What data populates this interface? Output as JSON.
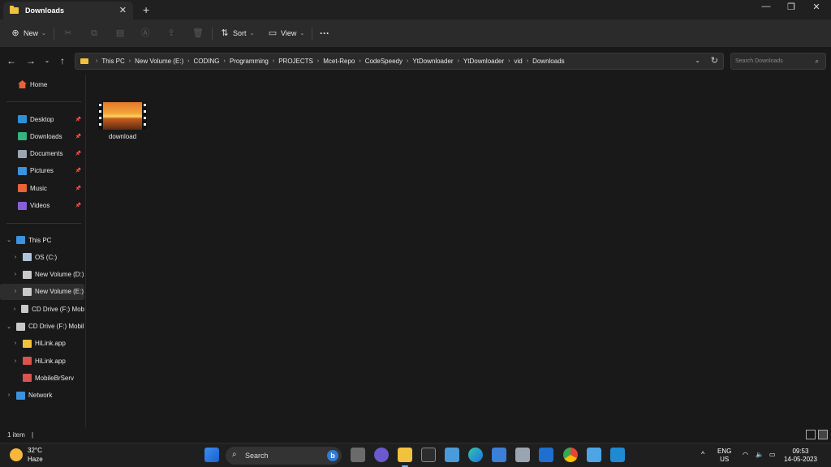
{
  "window": {
    "tab_title": "Downloads",
    "tab_close": "✕",
    "new_tab": "+"
  },
  "commandbar": {
    "new_label": "New",
    "sort_label": "Sort",
    "view_label": "View",
    "more": "···"
  },
  "address": {
    "crumbs": [
      "This PC",
      "New Volume (E:)",
      "CODING",
      "Programming",
      "PROJECTS",
      "Mcet-Repo",
      "CodeSpeedy",
      "YtDownloader",
      "YtDownloader",
      "vid",
      "Downloads"
    ],
    "search_placeholder": "Search Downloads"
  },
  "sidebar": {
    "home": "Home",
    "quick": [
      {
        "label": "Desktop",
        "icon": "desktop-icon",
        "color": "#2f8fd8"
      },
      {
        "label": "Downloads",
        "icon": "download-icon",
        "color": "#36b37e"
      },
      {
        "label": "Documents",
        "icon": "document-icon",
        "color": "#9aa5b1"
      },
      {
        "label": "Pictures",
        "icon": "pictures-icon",
        "color": "#3c92dc"
      },
      {
        "label": "Music",
        "icon": "music-icon",
        "color": "#e8623a"
      },
      {
        "label": "Videos",
        "icon": "videos-icon",
        "color": "#8a5fd6"
      }
    ],
    "tree": [
      {
        "label": "This PC",
        "level": 0,
        "expanded": true
      },
      {
        "label": "OS (C:)",
        "level": 1,
        "expanded": false
      },
      {
        "label": "New Volume (D:)",
        "level": 1,
        "expanded": false
      },
      {
        "label": "New Volume (E:)",
        "level": 1,
        "expanded": false,
        "selected": true
      },
      {
        "label": "CD Drive (F:) Mob",
        "level": 1,
        "expanded": false
      },
      {
        "label": "CD Drive (F:) Mobil",
        "level": 0,
        "expanded": true
      },
      {
        "label": "HiLink.app",
        "level": 1,
        "expanded": false
      },
      {
        "label": "HiLink.app",
        "level": 1,
        "expanded": false
      },
      {
        "label": "MobileBrServ",
        "level": 1,
        "expanded": null
      },
      {
        "label": "Network",
        "level": 0,
        "expanded": false
      }
    ]
  },
  "content": {
    "files": [
      {
        "name": "download",
        "type": "video"
      }
    ]
  },
  "status": {
    "item_count": "1 item",
    "separator": "|"
  },
  "taskbar": {
    "temperature": "32°C",
    "condition": "Haze",
    "search_label": "Search",
    "lang_1": "ENG",
    "lang_2": "US",
    "time": "09:53",
    "date": "14-05-2023"
  },
  "colors": {
    "accent": "#7ab7ff",
    "folder": "#f2c23e",
    "background": "#191919"
  }
}
